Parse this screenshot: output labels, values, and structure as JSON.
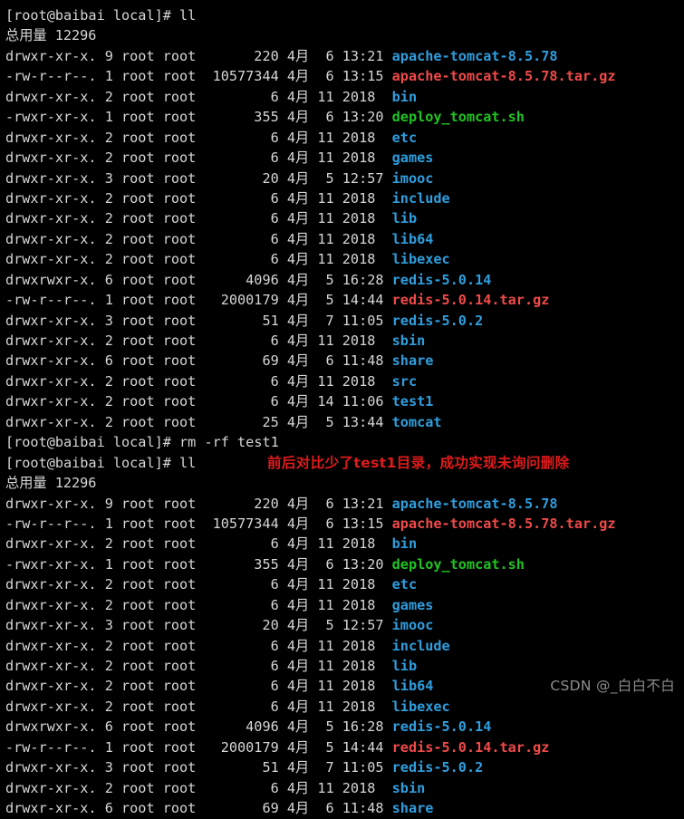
{
  "terminal": {
    "title": "root@baibai:/usr/local",
    "prompt": "[root@baibai local]# ",
    "background_color": "#000000",
    "colors": {
      "default_text": "#d6d6d6",
      "directory": "#2f9ede",
      "archive": "#f04a4a",
      "executable": "#20c420",
      "annotation": "#e01b1b",
      "watermark": "#8d8d8d"
    },
    "total_label": "总用量 12296",
    "commands": {
      "list": "ll",
      "remove": "rm -rf test1"
    },
    "annotation": "前后对比少了test1目录，成功实现未询问删除",
    "watermark": "CSDN @_白白不白",
    "listing_first": [
      {
        "perms": "drwxr-xr-x.",
        "links": "9",
        "owner": "root",
        "group": "root",
        "size": "220",
        "month": "4月",
        "day": "6",
        "time": "13:21",
        "name": "apache-tomcat-8.5.78",
        "type": "dir"
      },
      {
        "perms": "-rw-r--r--.",
        "links": "1",
        "owner": "root",
        "group": "root",
        "size": "10577344",
        "month": "4月",
        "day": "6",
        "time": "13:15",
        "name": "apache-tomcat-8.5.78.tar.gz",
        "type": "archive"
      },
      {
        "perms": "drwxr-xr-x.",
        "links": "2",
        "owner": "root",
        "group": "root",
        "size": "6",
        "month": "4月",
        "day": "11",
        "time": "2018",
        "name": "bin",
        "type": "dir"
      },
      {
        "perms": "-rwxr-xr-x.",
        "links": "1",
        "owner": "root",
        "group": "root",
        "size": "355",
        "month": "4月",
        "day": "6",
        "time": "13:20",
        "name": "deploy_tomcat.sh",
        "type": "exec"
      },
      {
        "perms": "drwxr-xr-x.",
        "links": "2",
        "owner": "root",
        "group": "root",
        "size": "6",
        "month": "4月",
        "day": "11",
        "time": "2018",
        "name": "etc",
        "type": "dir"
      },
      {
        "perms": "drwxr-xr-x.",
        "links": "2",
        "owner": "root",
        "group": "root",
        "size": "6",
        "month": "4月",
        "day": "11",
        "time": "2018",
        "name": "games",
        "type": "dir"
      },
      {
        "perms": "drwxr-xr-x.",
        "links": "3",
        "owner": "root",
        "group": "root",
        "size": "20",
        "month": "4月",
        "day": "5",
        "time": "12:57",
        "name": "imooc",
        "type": "dir"
      },
      {
        "perms": "drwxr-xr-x.",
        "links": "2",
        "owner": "root",
        "group": "root",
        "size": "6",
        "month": "4月",
        "day": "11",
        "time": "2018",
        "name": "include",
        "type": "dir"
      },
      {
        "perms": "drwxr-xr-x.",
        "links": "2",
        "owner": "root",
        "group": "root",
        "size": "6",
        "month": "4月",
        "day": "11",
        "time": "2018",
        "name": "lib",
        "type": "dir"
      },
      {
        "perms": "drwxr-xr-x.",
        "links": "2",
        "owner": "root",
        "group": "root",
        "size": "6",
        "month": "4月",
        "day": "11",
        "time": "2018",
        "name": "lib64",
        "type": "dir"
      },
      {
        "perms": "drwxr-xr-x.",
        "links": "2",
        "owner": "root",
        "group": "root",
        "size": "6",
        "month": "4月",
        "day": "11",
        "time": "2018",
        "name": "libexec",
        "type": "dir"
      },
      {
        "perms": "drwxrwxr-x.",
        "links": "6",
        "owner": "root",
        "group": "root",
        "size": "4096",
        "month": "4月",
        "day": "5",
        "time": "16:28",
        "name": "redis-5.0.14",
        "type": "dir"
      },
      {
        "perms": "-rw-r--r--.",
        "links": "1",
        "owner": "root",
        "group": "root",
        "size": "2000179",
        "month": "4月",
        "day": "5",
        "time": "14:44",
        "name": "redis-5.0.14.tar.gz",
        "type": "archive"
      },
      {
        "perms": "drwxr-xr-x.",
        "links": "3",
        "owner": "root",
        "group": "root",
        "size": "51",
        "month": "4月",
        "day": "7",
        "time": "11:05",
        "name": "redis-5.0.2",
        "type": "dir"
      },
      {
        "perms": "drwxr-xr-x.",
        "links": "2",
        "owner": "root",
        "group": "root",
        "size": "6",
        "month": "4月",
        "day": "11",
        "time": "2018",
        "name": "sbin",
        "type": "dir"
      },
      {
        "perms": "drwxr-xr-x.",
        "links": "6",
        "owner": "root",
        "group": "root",
        "size": "69",
        "month": "4月",
        "day": "6",
        "time": "11:48",
        "name": "share",
        "type": "dir"
      },
      {
        "perms": "drwxr-xr-x.",
        "links": "2",
        "owner": "root",
        "group": "root",
        "size": "6",
        "month": "4月",
        "day": "11",
        "time": "2018",
        "name": "src",
        "type": "dir"
      },
      {
        "perms": "drwxr-xr-x.",
        "links": "2",
        "owner": "root",
        "group": "root",
        "size": "6",
        "month": "4月",
        "day": "14",
        "time": "11:06",
        "name": "test1",
        "type": "dir"
      },
      {
        "perms": "drwxr-xr-x.",
        "links": "2",
        "owner": "root",
        "group": "root",
        "size": "25",
        "month": "4月",
        "day": "5",
        "time": "13:44",
        "name": "tomcat",
        "type": "dir"
      }
    ],
    "listing_second": [
      {
        "perms": "drwxr-xr-x.",
        "links": "9",
        "owner": "root",
        "group": "root",
        "size": "220",
        "month": "4月",
        "day": "6",
        "time": "13:21",
        "name": "apache-tomcat-8.5.78",
        "type": "dir"
      },
      {
        "perms": "-rw-r--r--.",
        "links": "1",
        "owner": "root",
        "group": "root",
        "size": "10577344",
        "month": "4月",
        "day": "6",
        "time": "13:15",
        "name": "apache-tomcat-8.5.78.tar.gz",
        "type": "archive"
      },
      {
        "perms": "drwxr-xr-x.",
        "links": "2",
        "owner": "root",
        "group": "root",
        "size": "6",
        "month": "4月",
        "day": "11",
        "time": "2018",
        "name": "bin",
        "type": "dir"
      },
      {
        "perms": "-rwxr-xr-x.",
        "links": "1",
        "owner": "root",
        "group": "root",
        "size": "355",
        "month": "4月",
        "day": "6",
        "time": "13:20",
        "name": "deploy_tomcat.sh",
        "type": "exec"
      },
      {
        "perms": "drwxr-xr-x.",
        "links": "2",
        "owner": "root",
        "group": "root",
        "size": "6",
        "month": "4月",
        "day": "11",
        "time": "2018",
        "name": "etc",
        "type": "dir"
      },
      {
        "perms": "drwxr-xr-x.",
        "links": "2",
        "owner": "root",
        "group": "root",
        "size": "6",
        "month": "4月",
        "day": "11",
        "time": "2018",
        "name": "games",
        "type": "dir"
      },
      {
        "perms": "drwxr-xr-x.",
        "links": "3",
        "owner": "root",
        "group": "root",
        "size": "20",
        "month": "4月",
        "day": "5",
        "time": "12:57",
        "name": "imooc",
        "type": "dir"
      },
      {
        "perms": "drwxr-xr-x.",
        "links": "2",
        "owner": "root",
        "group": "root",
        "size": "6",
        "month": "4月",
        "day": "11",
        "time": "2018",
        "name": "include",
        "type": "dir"
      },
      {
        "perms": "drwxr-xr-x.",
        "links": "2",
        "owner": "root",
        "group": "root",
        "size": "6",
        "month": "4月",
        "day": "11",
        "time": "2018",
        "name": "lib",
        "type": "dir"
      },
      {
        "perms": "drwxr-xr-x.",
        "links": "2",
        "owner": "root",
        "group": "root",
        "size": "6",
        "month": "4月",
        "day": "11",
        "time": "2018",
        "name": "lib64",
        "type": "dir"
      },
      {
        "perms": "drwxr-xr-x.",
        "links": "2",
        "owner": "root",
        "group": "root",
        "size": "6",
        "month": "4月",
        "day": "11",
        "time": "2018",
        "name": "libexec",
        "type": "dir"
      },
      {
        "perms": "drwxrwxr-x.",
        "links": "6",
        "owner": "root",
        "group": "root",
        "size": "4096",
        "month": "4月",
        "day": "5",
        "time": "16:28",
        "name": "redis-5.0.14",
        "type": "dir"
      },
      {
        "perms": "-rw-r--r--.",
        "links": "1",
        "owner": "root",
        "group": "root",
        "size": "2000179",
        "month": "4月",
        "day": "5",
        "time": "14:44",
        "name": "redis-5.0.14.tar.gz",
        "type": "archive"
      },
      {
        "perms": "drwxr-xr-x.",
        "links": "3",
        "owner": "root",
        "group": "root",
        "size": "51",
        "month": "4月",
        "day": "7",
        "time": "11:05",
        "name": "redis-5.0.2",
        "type": "dir"
      },
      {
        "perms": "drwxr-xr-x.",
        "links": "2",
        "owner": "root",
        "group": "root",
        "size": "6",
        "month": "4月",
        "day": "11",
        "time": "2018",
        "name": "sbin",
        "type": "dir"
      },
      {
        "perms": "drwxr-xr-x.",
        "links": "6",
        "owner": "root",
        "group": "root",
        "size": "69",
        "month": "4月",
        "day": "6",
        "time": "11:48",
        "name": "share",
        "type": "dir"
      }
    ]
  }
}
